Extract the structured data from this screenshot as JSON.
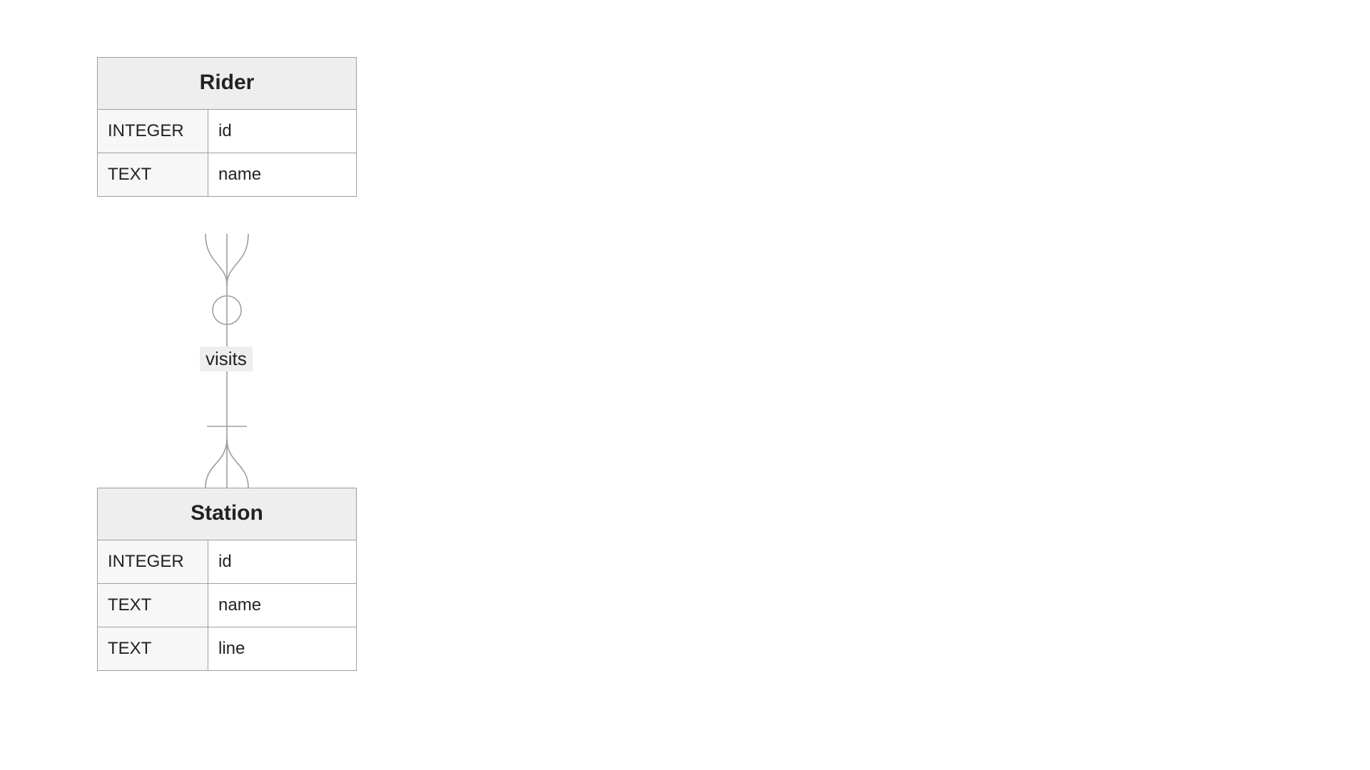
{
  "diagram": {
    "type": "entity-relationship",
    "entities": [
      {
        "name": "Rider",
        "attributes": [
          {
            "type": "INTEGER",
            "name": "id"
          },
          {
            "type": "TEXT",
            "name": "name"
          }
        ]
      },
      {
        "name": "Station",
        "attributes": [
          {
            "type": "INTEGER",
            "name": "id"
          },
          {
            "type": "TEXT",
            "name": "name"
          },
          {
            "type": "TEXT",
            "name": "line"
          }
        ]
      }
    ],
    "relationship": {
      "label": "visits",
      "from": "Rider",
      "to": "Station",
      "from_cardinality": "zero-or-many",
      "to_cardinality": "one-or-many"
    }
  }
}
